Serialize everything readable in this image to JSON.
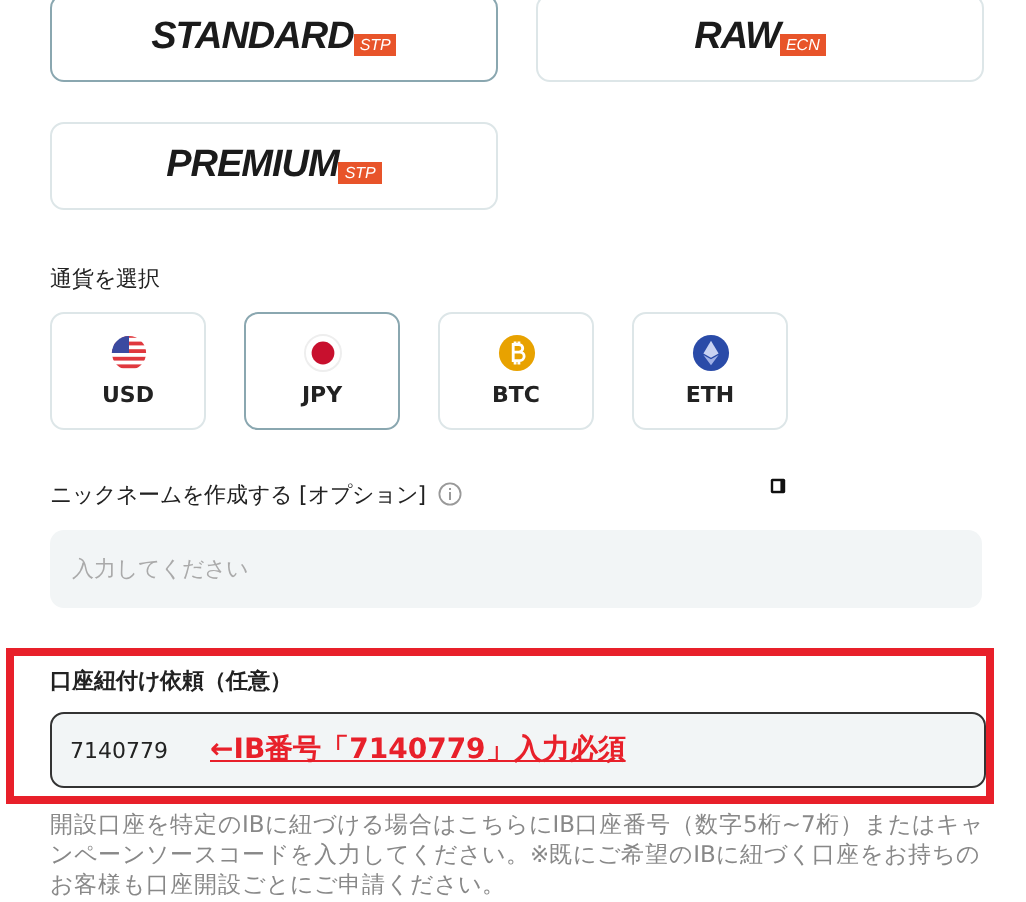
{
  "account_types": [
    {
      "name": "STANDARD",
      "tag": "STP",
      "selected": true
    },
    {
      "name": "RAW",
      "tag": "ECN",
      "selected": false
    },
    {
      "name": "PREMIUM",
      "tag": "STP",
      "selected": false
    }
  ],
  "currency": {
    "label": "通貨を選択",
    "options": [
      {
        "code": "USD",
        "kind": "usd",
        "selected": false
      },
      {
        "code": "JPY",
        "kind": "jpy",
        "selected": true
      },
      {
        "code": "BTC",
        "kind": "btc",
        "selected": false
      },
      {
        "code": "ETH",
        "kind": "eth",
        "selected": false
      }
    ]
  },
  "nickname": {
    "label": "ニックネームを作成する [オプション]",
    "placeholder": "入力してください"
  },
  "ib_link": {
    "label": "口座紐付け依頼（任意）",
    "value": "7140779",
    "annotation": "←IB番号「7140779」入力必須",
    "help": "開設口座を特定のIBに紐づける場合はこちらにIB口座番号（数字5桁~7桁）またはキャンペーンソースコードを入力してください。※既にご希望のIBに紐づく口座をお持ちのお客様も口座開設ごとにご申請ください。"
  }
}
